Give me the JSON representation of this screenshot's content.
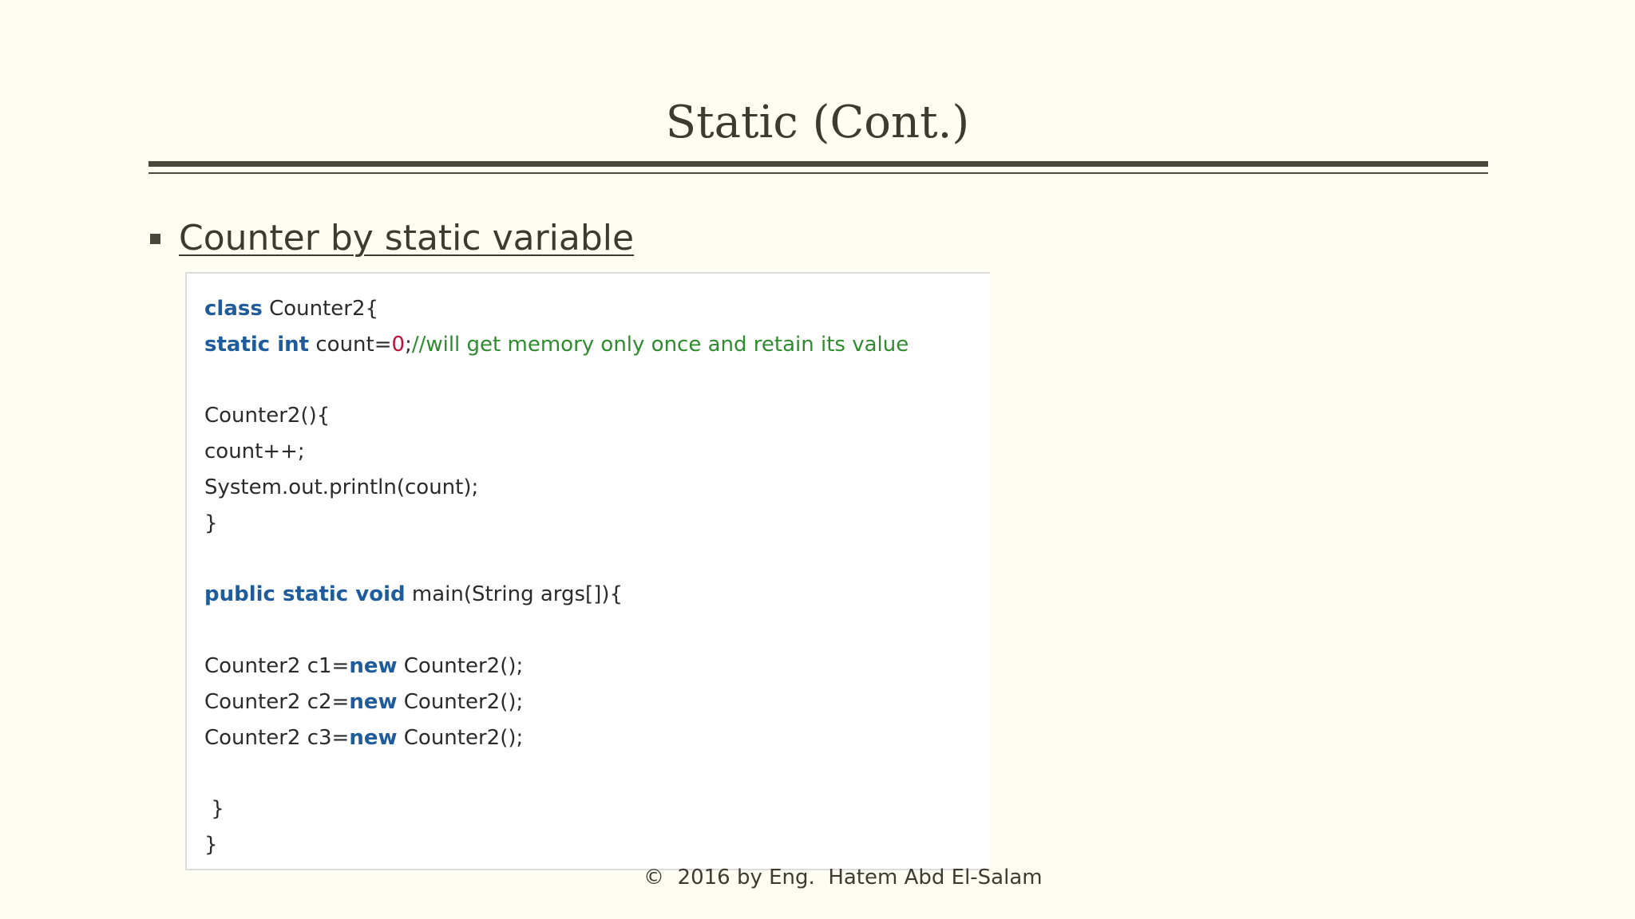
{
  "slide": {
    "title": "Static (Cont.)",
    "bullet_text": "Counter by static variable",
    "footer": "©  2016 by Eng.  Hatem Abd El-Salam"
  },
  "code": {
    "l1_kw": "class",
    "l1_rest": " Counter2{",
    "l2_kw": "static int",
    "l2_text": " count=",
    "l2_num": "0",
    "l2_semi": ";",
    "l2_comment": "//will get memory only once and retain its value",
    "l4": "Counter2(){",
    "l5": "count++;",
    "l6": "System.out.println(count);",
    "l7": "}",
    "l9_kw": "public static void",
    "l9_rest": " main(String args[]){",
    "l11_a": "Counter2 c1=",
    "l11_kw": "new",
    "l11_b": " Counter2();",
    "l12_a": "Counter2 c2=",
    "l12_kw": "new",
    "l12_b": " Counter2();",
    "l13_a": "Counter2 c3=",
    "l13_kw": "new",
    "l13_b": " Counter2();",
    "l15": " }",
    "l16": "}"
  }
}
